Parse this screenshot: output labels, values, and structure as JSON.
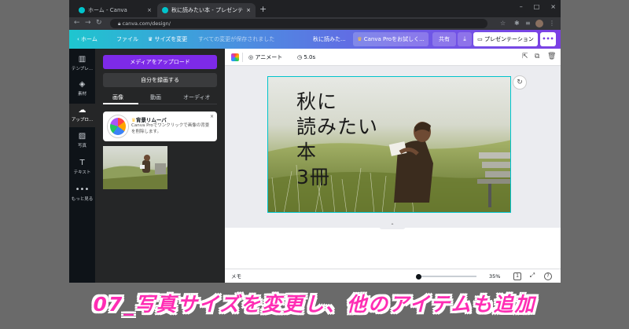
{
  "browser": {
    "tabs": [
      {
        "label": "ホーム - Canva",
        "close": "×"
      },
      {
        "label": "秋に読みたい本 - プレゼンテーション",
        "close": "×"
      }
    ],
    "new_tab": "+",
    "window_controls": [
      "–",
      "□",
      "×"
    ],
    "url": "canva.com/design/"
  },
  "header": {
    "home": "ホーム",
    "file": "ファイル",
    "resize": "サイズを変更",
    "save_status": "すべての変更が保存されました",
    "title": "秋に読みた...",
    "try_pro": "Canva Proをお試しく...",
    "share": "共有",
    "present": "プレゼンテーション",
    "more": "•••"
  },
  "rail": {
    "items": [
      {
        "icon": "template-icon",
        "label": "テンプレ..."
      },
      {
        "icon": "elements-icon",
        "label": "素材"
      },
      {
        "icon": "upload-icon",
        "label": "アップロ..."
      },
      {
        "icon": "photo-icon",
        "label": "写真"
      },
      {
        "icon": "text-icon",
        "label": "テキスト"
      },
      {
        "icon": "more-icon",
        "label": "もっと見る"
      }
    ],
    "active": 2
  },
  "panel": {
    "upload_button": "メディアをアップロード",
    "record_button": "自分を録画する",
    "tabs": [
      "画像",
      "動画",
      "オーディオ"
    ],
    "active_tab": 0,
    "promo": {
      "title": "背景リムーバ",
      "description": "Canva Proでワンクリックで画像の背景を削除します。",
      "close": "×"
    }
  },
  "toolbar": {
    "animate": "アニメート",
    "duration": "5.0s"
  },
  "slide": {
    "lines": [
      "秋に",
      "読みたい",
      "本",
      "3冊"
    ]
  },
  "footer": {
    "notes": "メモ",
    "zoom": "35%",
    "page": "1",
    "help": "?"
  },
  "caption": "07_写真サイズを変更し、他のアイテムも追加",
  "colors": {
    "accent_purple": "#7d2ae8",
    "selection": "#00c4cc",
    "caption": "#ff2db4"
  }
}
